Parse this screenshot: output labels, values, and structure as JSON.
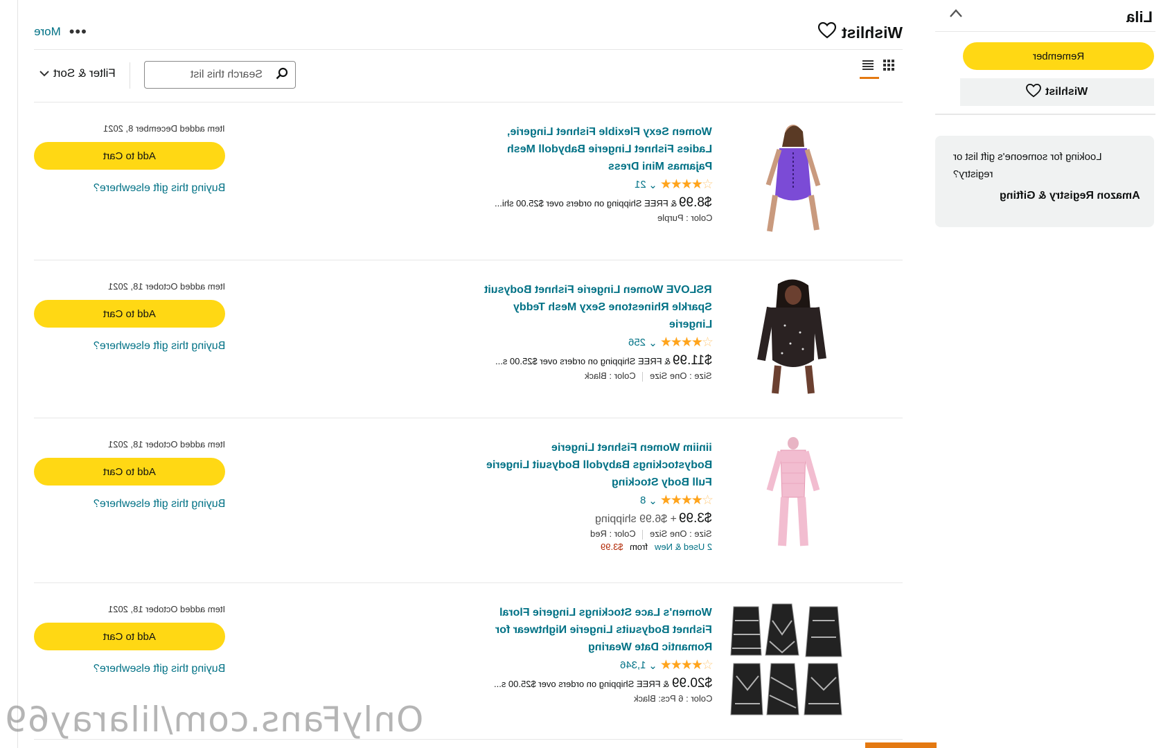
{
  "header": {
    "more_label": "More",
    "more_dots": "•••",
    "list_title": "Wishlist"
  },
  "toolbar": {
    "filter_sort_label": "Filter & Sort",
    "search_placeholder": "Search this list"
  },
  "items": [
    {
      "title_lines": [
        "Women Sexy Flexible Fishnet Lingerie,",
        "Ladies Fishnet Lingerie Babydoll Mesh",
        "Pajamas Mini Dress"
      ],
      "rating": 4.5,
      "review_count": "21",
      "price": "$8.99",
      "shipping": "& FREE Shipping on orders over $25.00 shi...",
      "meta": [
        "Color : Purple"
      ],
      "date_added": "Item added December 8, 2021",
      "add_to_cart": "Add to Cart",
      "elsewhere": "Buying this gift elsewhere?",
      "thumb": "purple-fishnet-dress"
    },
    {
      "title_lines": [
        "RSLOVE Women Lingerie Fishnet Bodysuit",
        "Sparkle Rhinestone Sexy Mesh Teddy",
        "Lingerie"
      ],
      "rating": 4.5,
      "review_count": "256",
      "price": "$11.99",
      "shipping": "& FREE Shipping on orders over $25.00 s...",
      "meta": [
        "Size : One Size",
        "Color : Black"
      ],
      "date_added": "Item added October 18, 2021",
      "add_to_cart": "Add to Cart",
      "elsewhere": "Buying this gift elsewhere?",
      "thumb": "black-rhinestone-bodysuit"
    },
    {
      "title_lines": [
        "iiniim Women Fishnet Lingerie",
        "Bodystockings Babydoll Bodysuit Lingerie",
        "Full Body Stocking"
      ],
      "rating": 4,
      "review_count": "8",
      "price": "$3.99",
      "shipping": "+ $6.99 shipping",
      "meta": [
        "Size : One Size",
        "Color : Red"
      ],
      "used_new": "2 Used & New",
      "used_from": "from",
      "used_price": "$3.99",
      "date_added": "Item added October 18, 2021",
      "add_to_cart": "Add to Cart",
      "elsewhere": "Buying this gift elsewhere?",
      "thumb": "pink-body-stocking"
    },
    {
      "title_lines": [
        "Women's Lace Stockings Lingerie Floral",
        "Fishnet Bodysuits Lingerie Nightwear for",
        "Romantic Date Wearing"
      ],
      "rating": 4,
      "review_count": "1,346",
      "price": "$20.99",
      "shipping": "& FREE Shipping on orders over $25.00 s...",
      "meta": [
        "Color : 6 Pcs: Black"
      ],
      "date_added": "Item added October 18, 2021",
      "add_to_cart": "Add to Cart",
      "elsewhere": "Buying this gift elsewhere?",
      "thumb": "six-black-dresses"
    }
  ],
  "side": {
    "owner_name": "Lila",
    "remember_label": "Remember",
    "wishlist_label": "Wishlist",
    "gift_question": "Looking for someone's gift list or registry?",
    "gift_link": "Amazon Registry & Gifting"
  },
  "watermark": "OnlyFans.com/lilaray69",
  "colors": {
    "accent": "#ffd814",
    "link": "#007185",
    "star": "#ffa41c",
    "tab_accent": "#e47911",
    "price_red": "#b12704"
  }
}
